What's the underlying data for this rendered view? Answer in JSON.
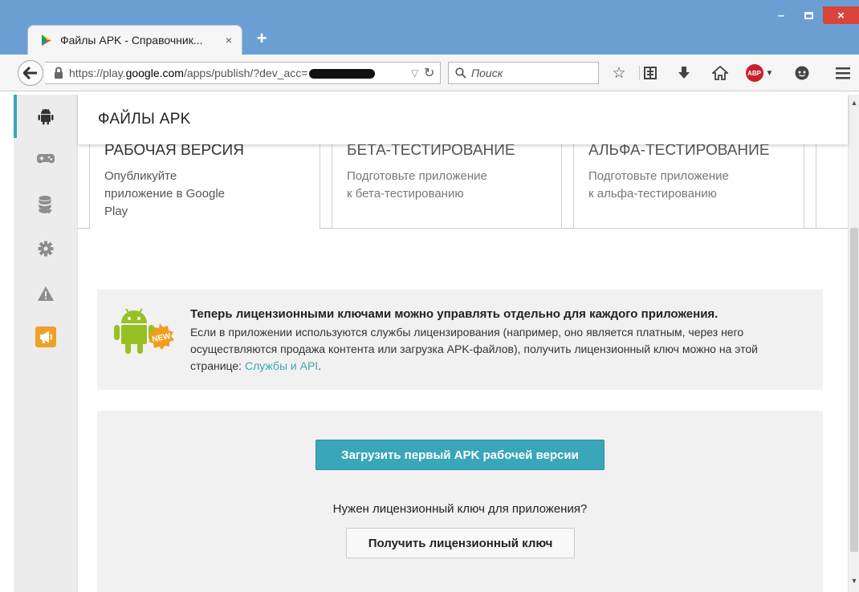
{
  "browser": {
    "tab_title": "Файлы APK - Справочник...",
    "tab_close": "×",
    "new_tab": "+",
    "url_prefix": "https://play.",
    "url_domain": "google.com",
    "url_path": "/apps/publish/?dev_acc=",
    "search_placeholder": "Поиск",
    "window_controls": {
      "minimize": "–",
      "close": "×"
    },
    "toolbar_icons": [
      "back-arrow-icon",
      "lock-icon",
      "reload-icon",
      "search-icon",
      "star-icon",
      "reading-list-icon",
      "download-icon",
      "home-icon",
      "adblock-icon",
      "chat-icon",
      "menu-icon"
    ],
    "adblock_label": "ABP"
  },
  "sidebar": {
    "items": [
      {
        "icon": "android-icon",
        "active": true
      },
      {
        "icon": "gamepad-icon"
      },
      {
        "icon": "database-icon"
      },
      {
        "icon": "gear-icon"
      },
      {
        "icon": "warning-icon"
      },
      {
        "icon": "megaphone-icon"
      }
    ]
  },
  "page": {
    "title": "ФАЙЛЫ APK"
  },
  "tracks": [
    {
      "title": "РАБОЧАЯ ВЕРСИЯ",
      "desc_lines": [
        "Опубликуйте",
        "приложение в Google",
        "Play"
      ],
      "active": true
    },
    {
      "title": "БЕТА-ТЕСТИРОВАНИЕ",
      "desc_lines": [
        "Подготовьте приложение",
        "к бета-тестированию"
      ]
    },
    {
      "title": "АЛЬФА-ТЕСТИРОВАНИЕ",
      "desc_lines": [
        "Подготовьте приложение",
        "к альфа-тестированию"
      ]
    }
  ],
  "banner": {
    "badge": "NEW",
    "headline": "Теперь лицензионными ключами можно управлять отдельно для каждого приложения.",
    "body": "Если в приложении используются службы лицензирования (например, оно является платным, через него осуществляются продажа контента или загрузка APK-файлов), получить лицензионный ключ можно на этой странице: ",
    "link": "Службы и API",
    "tail": "."
  },
  "upload": {
    "button": "Загрузить первый APK рабочей версии",
    "license_question": "Нужен лицензионный ключ для приложения?",
    "license_button": "Получить лицензионный ключ"
  },
  "colors": {
    "accent": "#3aa6b9",
    "titlebar": "#6b9fd4",
    "close_button": "#d9453b",
    "panel_bg": "#f1f1f1"
  }
}
